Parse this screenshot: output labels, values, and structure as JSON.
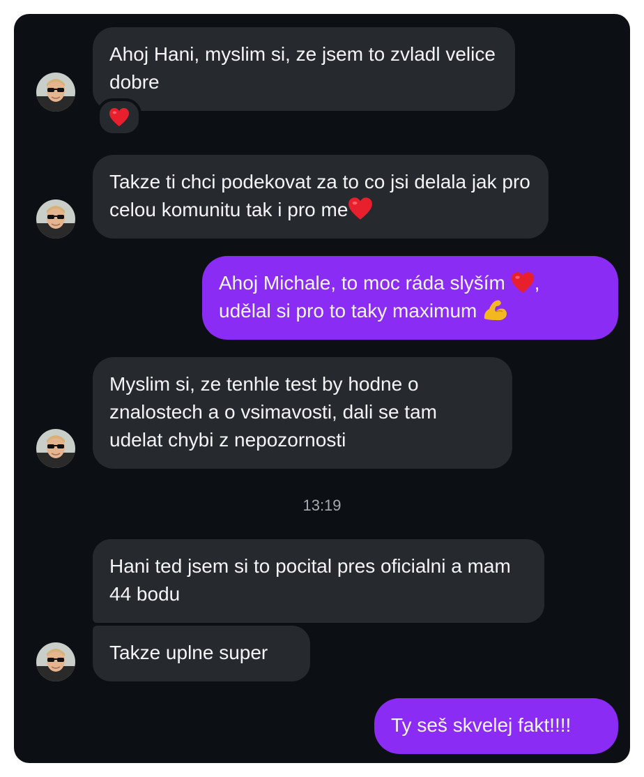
{
  "colors": {
    "background": "#0c1014",
    "incoming_bubble": "#26292e",
    "outgoing_bubble": "#8b2cf5",
    "text": "#f3f4f6",
    "timestamp": "#a7abb2"
  },
  "messages": [
    {
      "direction": "incoming",
      "text": "Ahoj Hani, myslim si, ze jsem to zvladl velice dobre",
      "reaction": "heart-icon"
    },
    {
      "direction": "incoming",
      "text": "Takze ti chci podekovat za to co jsi delala jak pro celou komunitu tak i pro me",
      "trailing_emoji": "heart-icon"
    },
    {
      "direction": "outgoing",
      "text_line1": "Ahoj Michale, to moc ráda slyším",
      "text_line1_end": ",",
      "text_line2": "udělal si pro to taky maximum",
      "emojis": [
        "heart-icon",
        "flexed-biceps-icon"
      ]
    },
    {
      "direction": "incoming",
      "text": "Myslim si, ze tenhle test by hodne o znalostech a o vsimavosti, dali se tam udelat chybi z nepozornosti"
    },
    {
      "direction": "incoming",
      "text": "Hani ted jsem si to pocital pres oficialni a mam 44 bodu"
    },
    {
      "direction": "incoming",
      "text": "Takze uplne super"
    },
    {
      "direction": "outgoing",
      "text": "Ty seš skvelej fakt!!!!"
    }
  ],
  "timestamp": "13:19"
}
